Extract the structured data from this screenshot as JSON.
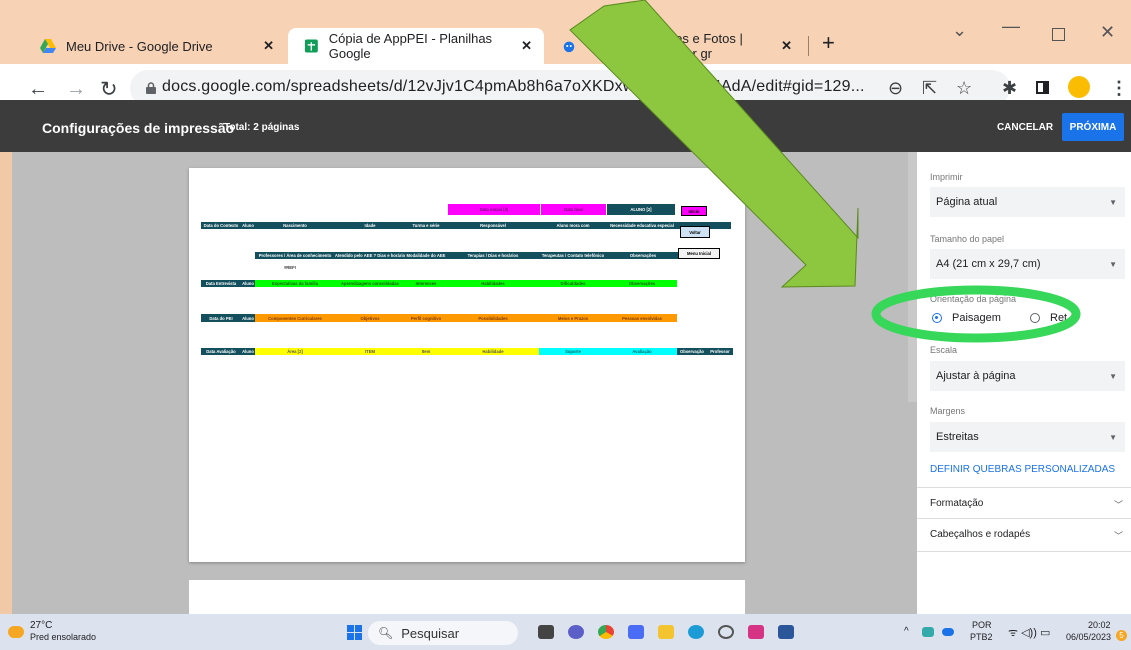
{
  "browser": {
    "tabs": [
      {
        "label": "Meu Drive - Google Drive",
        "icon": "google-drive-icon"
      },
      {
        "label": "Cópia de AppPEI - Planilhas Google",
        "icon": "google-sheets-icon"
      },
      {
        "label": "tores e Fotos | Baixar gr",
        "icon": "robot-icon"
      }
    ],
    "new_tab": "+",
    "url": "docs.google.com/spreadsheets/d/12vJjv1C4pmAb8h6a7oXKDxwiUV",
    "url_tail": "hodGJIAdA/edit#gid=129..."
  },
  "print": {
    "title": "Configurações de impressão",
    "total": "Total: 2 páginas",
    "cancel": "CANCELAR",
    "next": "PRÓXIMA"
  },
  "sidebar": {
    "print_label": "Imprimir",
    "print_value": "Página atual",
    "paper_label": "Tamanho do papel",
    "paper_value": "A4 (21 cm x 29,7 cm)",
    "orientation_label": "Orientação da página",
    "orientation_landscape": "Paisagem",
    "orientation_portrait": "Ret",
    "scale_label": "Escala",
    "scale_value": "Ajustar à página",
    "margins_label": "Margens",
    "margins_value": "Estreitas",
    "custom_breaks": "DEFINIR QUEBRAS PERSONALIZADAS",
    "formatting": "Formatação",
    "headers": "Cabeçalhos e rodapés"
  },
  "sheet": {
    "r1": [
      "Data inicial [3]",
      "Data final",
      "ALUNO [2]",
      "Início"
    ],
    "r2": [
      "Data do Contexto",
      "Aluno",
      "Nascimento",
      "Idade",
      "Turma e série",
      "Responsável",
      "Aluno mora com",
      "Necessidade educativa especial",
      "Voltar"
    ],
    "r3": [
      "Professores / Área de conhecimento",
      "Atendido pelo AEE ? Dias e horário",
      "Modalidade do AEE",
      "Terapias / Dias e horários",
      "Terapeutas / Contato telefônico",
      "Observações",
      "Menu Inicial"
    ],
    "r3b": "#REF!",
    "r4": [
      "Data Entrevista",
      "Aluno",
      "Expectativas da família",
      "Aprendizagens consolidadas",
      "Interesses",
      "Habilidades",
      "Dificuldades",
      "Observações"
    ],
    "r5": [
      "Data do PEI",
      "Aluno",
      "Componentes Curriculares",
      "Objetivos",
      "Perfil cognitivo",
      "Possibilidades",
      "Meios e Prazos",
      "Pessoas envolvidas"
    ],
    "r6": [
      "Data Avaliação",
      "Aluno",
      "Área [2]",
      "ITEM",
      "Item",
      "Habilidade",
      "Suporte",
      "Avaliação",
      "Observação",
      "Professor"
    ]
  },
  "taskbar": {
    "weather_temp": "27°C",
    "weather_desc": "Pred ensolarado",
    "search": "Pesquisar",
    "lang1": "POR",
    "lang2": "PTB2",
    "time": "20:02",
    "date": "06/05/2023",
    "badge": "5"
  },
  "colors": {
    "accent": "#1a73e8",
    "highlight_ellipse": "#37d85a",
    "arrow": "#8dc63f",
    "magenta": "#ff00ff",
    "teal": "#134f5c",
    "green": "#00ff00",
    "orange": "#ff9900",
    "yellow": "#ffff00",
    "cyan": "#00ffff"
  }
}
